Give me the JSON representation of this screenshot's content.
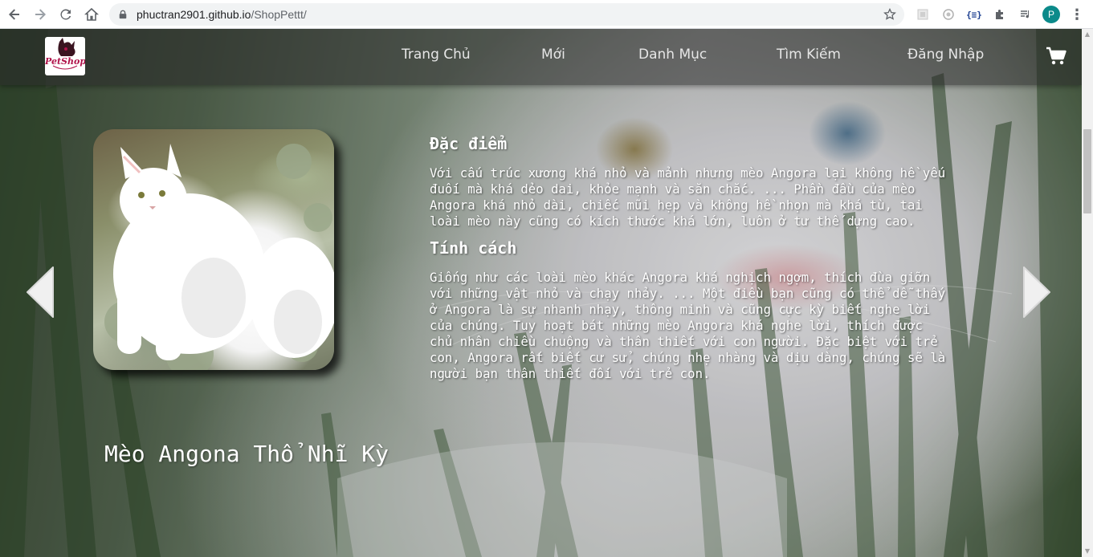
{
  "browser": {
    "url_host": "phuctran2901.github.io",
    "url_path": "/ShopPettt/",
    "profile_initial": "P",
    "icons": [
      "back-icon",
      "forward-icon",
      "reload-icon",
      "home-icon",
      "lock-icon",
      "star-icon",
      "extension-icon",
      "puzzle-icon",
      "media-icon",
      "kebab-menu-icon"
    ]
  },
  "site": {
    "logo_text": "PetShop",
    "nav": {
      "home": "Trang Chủ",
      "new": "Mới",
      "category": "Danh Mục",
      "search": "Tìm Kiếm",
      "login": "Đăng Nhập"
    }
  },
  "product": {
    "name": "Mèo Angona Thổ Nhĩ Kỳ",
    "traits_title": "Đặc điểm",
    "traits_text": "Với cấu trúc xương khá nhỏ và mảnh nhưng mèo Angora lại không hề yếu\nđuối mà khá dẻo dai, khỏe mạnh và săn chắc. ... Phần đầu của mèo\nAngora khá nhỏ dài, chiếc mũi hẹp và không hề nhọn mà khá tù, tai\nloài mèo này cũng có kích thước khá lớn, luôn ở tư thế dựng cao.",
    "personality_title": "Tính cách",
    "personality_text": "Giống như các loài mèo khác Angora khá nghịch ngợm, thích đùa giỡn\nvới những vật nhỏ và chạy nhảy. ... Một điều bạn cũng có thể dễ thấy\nở Angora là sự nhanh nhạy, thông minh và cũng cực kỳ biết nghe lời\ncủa chúng. Tuy hoạt bát những mèo Angora khá nghe lời, thích được\nchủ nhân chiều chuộng và thân thiết với con người. Đặc biệt với trẻ\ncon, Angora rất biết cư sử, chúng nhẹ nhàng và dịu dàng, chúng sẽ là\nngười bạn thân thiết đối với trẻ con."
  },
  "colors": {
    "logo_accent": "#b0124a",
    "text": "#ffffff",
    "header_overlay": "rgba(40,40,40,0.55)"
  }
}
